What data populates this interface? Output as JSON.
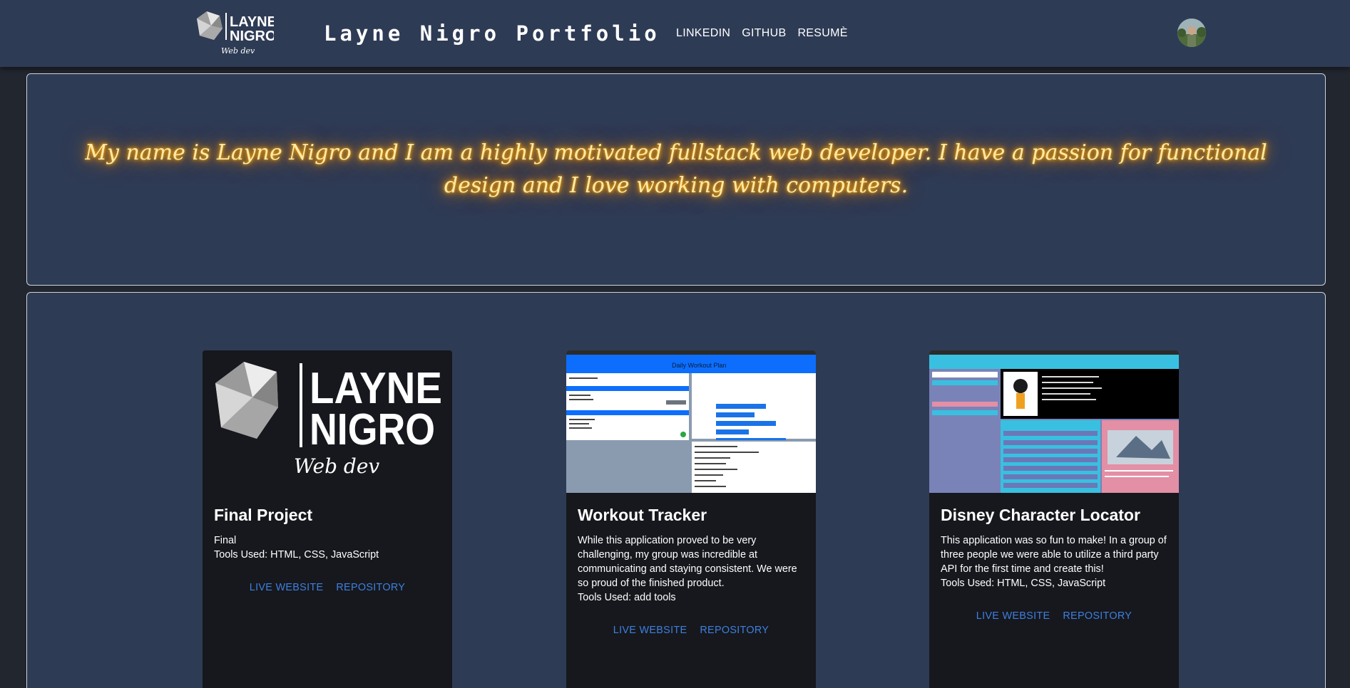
{
  "header": {
    "logo_text": [
      "LAYNE",
      "NIGRO"
    ],
    "logo_subtitle": "Web dev",
    "title": "Layne Nigro Portfolio",
    "nav": [
      {
        "label": "LINKEDIN"
      },
      {
        "label": "GITHUB"
      },
      {
        "label": "RESUMÈ"
      }
    ]
  },
  "bio": {
    "text": "My name is Layne Nigro and I am a highly motivated fullstack web developer. I have a passion for functional design and I love working with computers."
  },
  "projects": [
    {
      "title": "Final Project",
      "description": "Final",
      "tools": "Tools Used: HTML, CSS, JavaScript",
      "live_label": "LIVE WEBSITE",
      "repo_label": "REPOSITORY",
      "thumb_logo_text": [
        "LAYNE",
        "NIGRO"
      ],
      "thumb_logo_subtitle": "Web dev"
    },
    {
      "title": "Workout Tracker",
      "description": "While this application proved to be very challenging, my group was incredible at communicating and staying consistent. We were so proud of the finished product.",
      "tools": "Tools Used: add tools",
      "live_label": "LIVE WEBSITE",
      "repo_label": "REPOSITORY",
      "thumb_heading": "Daily Workout Plan"
    },
    {
      "title": "Disney Character Locator",
      "description": "This application was so fun to make! In a group of three people we were able to utilize a third party API for the first time and create this!",
      "tools": "Tools Used: HTML, CSS, JavaScript",
      "live_label": "LIVE WEBSITE",
      "repo_label": "REPOSITORY"
    }
  ],
  "colors": {
    "header_bg": "#2e3b55",
    "page_bg": "#22262e",
    "card_bg": "#16181d",
    "link": "#3f7fe0",
    "glow": "#ff9800"
  }
}
